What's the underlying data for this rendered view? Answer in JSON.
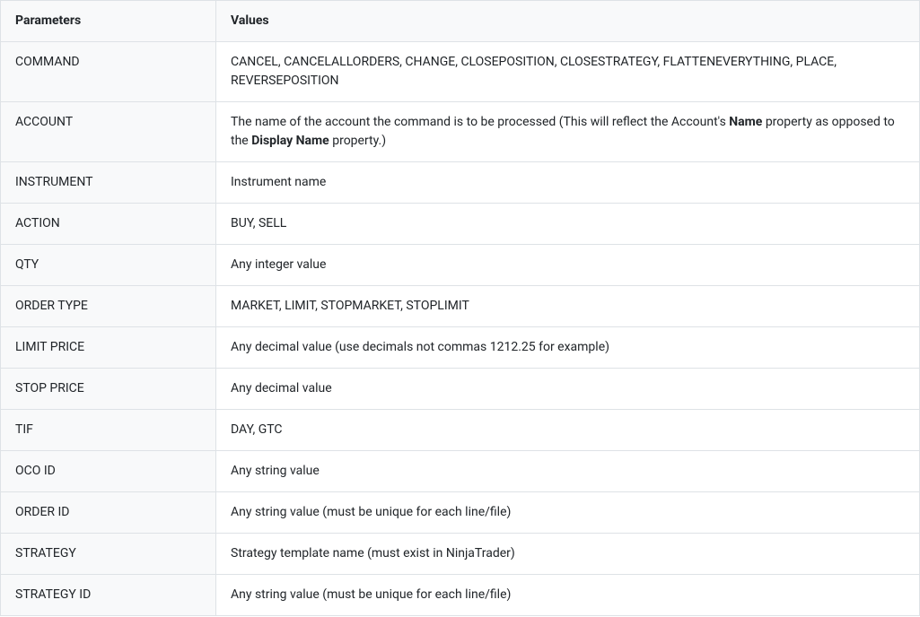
{
  "table": {
    "headers": {
      "parameters": "Parameters",
      "values": "Values"
    },
    "rows": [
      {
        "param": "COMMAND",
        "value_plain": "CANCEL, CANCELALLORDERS, CHANGE, CLOSEPOSITION, CLOSESTRATEGY, FLATTENEVERYTHING, PLACE, REVERSEPOSITION"
      },
      {
        "param": "ACCOUNT",
        "value_parts": {
          "p0": "The name of the account the command is to be processed (This will reflect the Account's ",
          "b0": "Name",
          "p1": " property as opposed to the ",
          "b1": "Display Name",
          "p2": " property.)"
        }
      },
      {
        "param": "INSTRUMENT",
        "value_plain": "Instrument name"
      },
      {
        "param": "ACTION",
        "value_plain": "BUY, SELL"
      },
      {
        "param": "QTY",
        "value_plain": "Any integer value"
      },
      {
        "param": "ORDER TYPE",
        "value_plain": "MARKET, LIMIT, STOPMARKET, STOPLIMIT"
      },
      {
        "param": "LIMIT PRICE",
        "value_plain": "Any decimal value (use decimals not commas 1212.25 for example)"
      },
      {
        "param": "STOP PRICE",
        "value_plain": "Any decimal value"
      },
      {
        "param": "TIF",
        "value_plain": "DAY, GTC"
      },
      {
        "param": "OCO ID",
        "value_plain": "Any string value"
      },
      {
        "param": "ORDER ID",
        "value_plain": "Any string value (must be unique for each line/file)"
      },
      {
        "param": "STRATEGY",
        "value_plain": "Strategy template name (must exist in NinjaTrader)"
      },
      {
        "param": "STRATEGY ID",
        "value_plain": "Any string value (must be unique for each line/file)"
      }
    ]
  }
}
